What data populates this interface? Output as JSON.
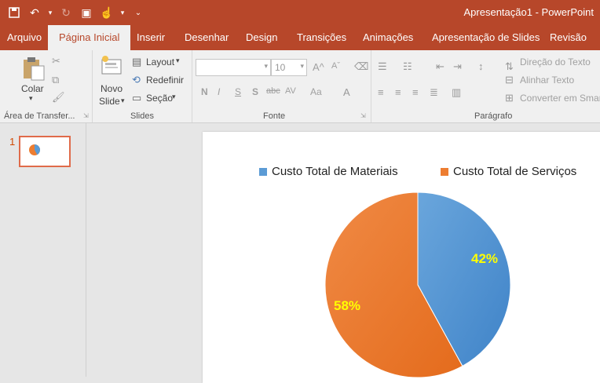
{
  "app": {
    "title": "Apresentação1  -  PowerPoint"
  },
  "tabs": [
    "Arquivo",
    "Página Inicial",
    "Inserir",
    "Desenhar",
    "Design",
    "Transições",
    "Animações",
    "Apresentação de Slides",
    "Revisão"
  ],
  "ribbon": {
    "clipboard": {
      "paste_label": "Colar",
      "group_label": "Área de Transfer..."
    },
    "slides": {
      "new_slide_line1": "Novo",
      "new_slide_line2": "Slide",
      "layout": "Layout",
      "reset": "Redefinir",
      "section": "Seção",
      "group_label": "Slides"
    },
    "font": {
      "size_value": "10",
      "group_label": "Fonte",
      "bold": "N",
      "italic": "I",
      "underline": "S",
      "shadow": "S",
      "strike": "abc",
      "spacing": "AV",
      "case": "Aa"
    },
    "paragraph": {
      "text_direction": "Direção do Texto",
      "align_text": "Alinhar Texto",
      "convert_smartart": "Converter em Smar",
      "group_label": "Parágrafo"
    }
  },
  "slides_panel": {
    "slide_number": "1"
  },
  "chart_data": {
    "type": "pie",
    "series": [
      {
        "name": "Custo Total de Materiais",
        "value": 42,
        "label": "42%",
        "color": "#5b9bd5"
      },
      {
        "name": "Custo Total  de Serviços",
        "value": 58,
        "label": "58%",
        "color": "#ed7d31"
      }
    ],
    "legend_position": "top",
    "label_color": "#ffff00"
  }
}
